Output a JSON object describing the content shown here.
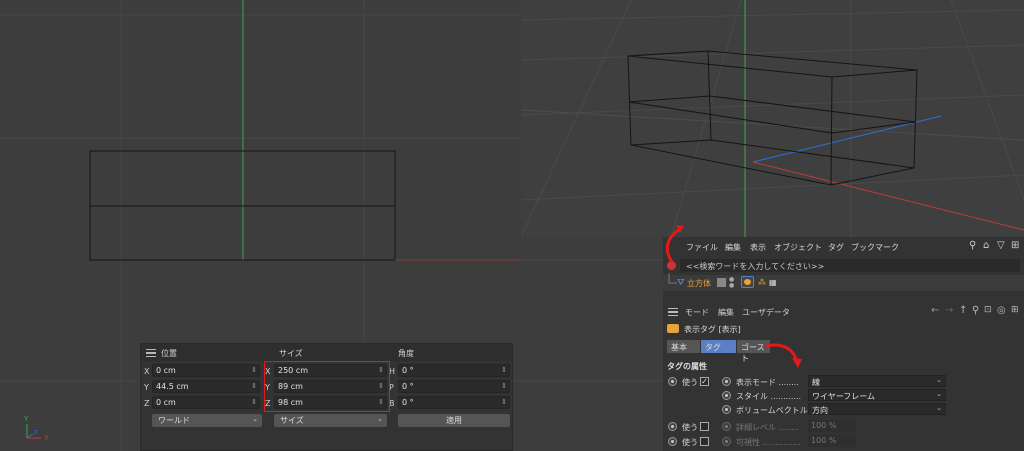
{
  "coordinate_manager": {
    "headers": {
      "position": "位置",
      "size": "サイズ",
      "rotation": "角度"
    },
    "rows": [
      {
        "pos_axis": "X",
        "pos_value": "0 cm",
        "size_axis": "X",
        "size_value": "250 cm",
        "rot_axis": "H",
        "rot_value": "0 °"
      },
      {
        "pos_axis": "Y",
        "pos_value": "44.5 cm",
        "size_axis": "Y",
        "size_value": "89 cm",
        "rot_axis": "P",
        "rot_value": "0 °"
      },
      {
        "pos_axis": "Z",
        "pos_value": "0 cm",
        "size_axis": "Z",
        "size_value": "98 cm",
        "rot_axis": "B",
        "rot_value": "0 °"
      }
    ],
    "coord_system_select": "ワールド",
    "size_mode_select": "サイズ",
    "apply_button": "適用"
  },
  "axis_gizmo": {
    "y": "Y",
    "x": "X",
    "z": "Z"
  },
  "object_manager": {
    "menu": [
      "ファイル",
      "編集",
      "表示",
      "オブジェクト",
      "タグ",
      "ブックマーク"
    ],
    "search_placeholder": "<<検索ワードを入力してください>>",
    "object_name": "立方体"
  },
  "attribute_manager": {
    "menu": [
      "モード",
      "編集",
      "ユーザデータ"
    ],
    "title": "表示タグ [表示]",
    "tabs": [
      "基本",
      "タグ",
      "ゴースト"
    ],
    "active_tab": "タグ",
    "section_title": "タグの属性",
    "rows": [
      {
        "use_label": "使う",
        "use_checked": true,
        "label": "表示モード ........",
        "value": "線",
        "enabled": true
      },
      {
        "use_label": "",
        "use_checked": false,
        "label": "スタイル ............",
        "value": "ワイヤーフレーム",
        "enabled": true
      },
      {
        "use_label": "",
        "use_checked": false,
        "label": "ボリュームベクトル",
        "value": "方向",
        "enabled": true
      },
      {
        "use_label": "使う",
        "use_checked": false,
        "label": "詳細レベル ........",
        "value": "100 %",
        "enabled": false
      },
      {
        "use_label": "使う",
        "use_checked": false,
        "label": "可視性 ...............",
        "value": "100 %",
        "enabled": false
      }
    ]
  },
  "colors": {
    "y_axis_green": "#3fa84a",
    "x_axis_red": "#c23a3a",
    "z_axis_blue": "#2f6fd6",
    "annotation_red": "#e31a1a",
    "active_tab_blue": "#5b7fc4",
    "object_name_orange": "#e8a33a"
  }
}
